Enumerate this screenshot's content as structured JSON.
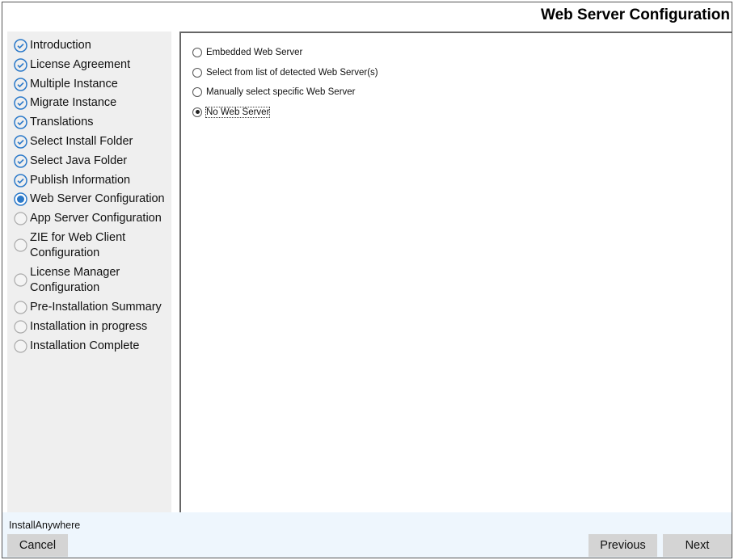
{
  "header": {
    "title": "Web Server Configuration"
  },
  "sidebar": {
    "steps": [
      {
        "label": "Introduction",
        "status": "done"
      },
      {
        "label": "License Agreement",
        "status": "done"
      },
      {
        "label": "Multiple Instance",
        "status": "done"
      },
      {
        "label": "Migrate Instance",
        "status": "done"
      },
      {
        "label": "Translations",
        "status": "done"
      },
      {
        "label": "Select Install Folder",
        "status": "done"
      },
      {
        "label": "Select Java Folder",
        "status": "done"
      },
      {
        "label": "Publish Information",
        "status": "done"
      },
      {
        "label": "Web Server Configuration",
        "status": "current"
      },
      {
        "label": "App Server Configuration",
        "status": "pending"
      },
      {
        "label": "ZIE for Web Client\nConfiguration",
        "status": "pending"
      },
      {
        "label": "License Manager\nConfiguration",
        "status": "pending"
      },
      {
        "label": "Pre-Installation Summary",
        "status": "pending"
      },
      {
        "label": "Installation in progress",
        "status": "pending"
      },
      {
        "label": "Installation Complete",
        "status": "pending"
      }
    ]
  },
  "options": [
    {
      "label": "Embedded Web Server",
      "selected": false
    },
    {
      "label": "Select from list of detected Web Server(s)",
      "selected": false
    },
    {
      "label": "Manually select specific Web Server",
      "selected": false
    },
    {
      "label": "No Web Server",
      "selected": true
    }
  ],
  "footer": {
    "brand": "InstallAnywhere",
    "cancel": "Cancel",
    "previous": "Previous",
    "next": "Next"
  },
  "colors": {
    "accent": "#2b79c9",
    "sidebar": "#efefef",
    "footer": "#eef6fd",
    "button": "#d4d4d4"
  }
}
